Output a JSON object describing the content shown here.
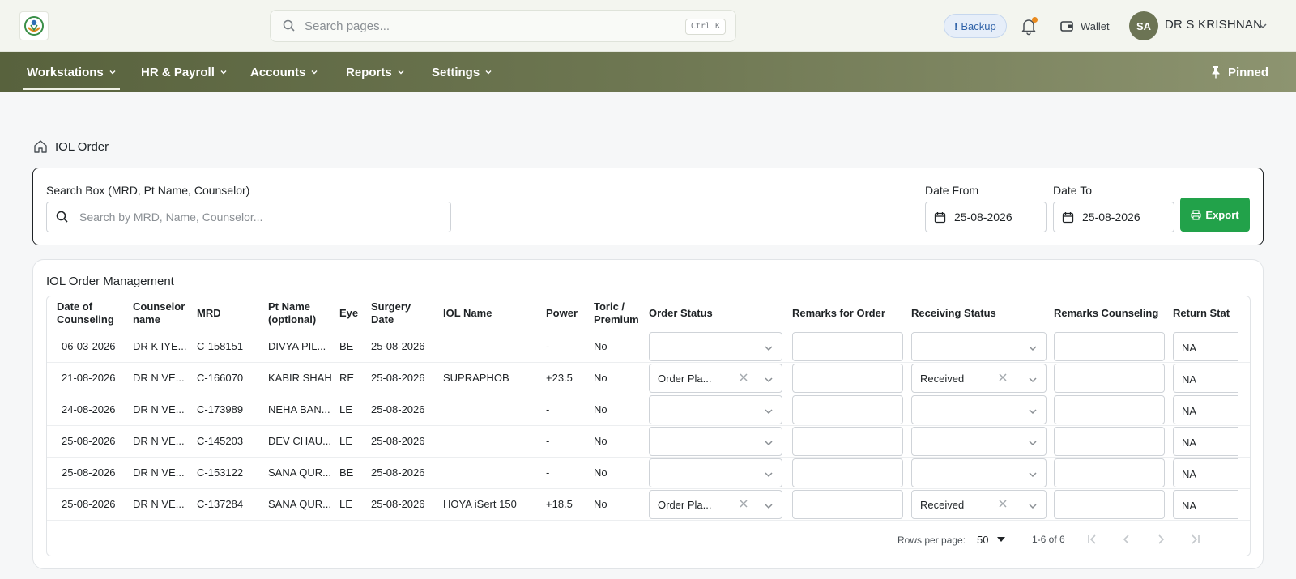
{
  "header": {
    "search_placeholder": "Search pages...",
    "shortcut": "Ctrl K",
    "backup_label": "Backup",
    "wallet_label": "Wallet",
    "avatar_initials": "SA",
    "user_name": "DR S KRISHNAN"
  },
  "nav": {
    "items": [
      {
        "label": "Workstations",
        "active": true
      },
      {
        "label": "HR & Payroll",
        "active": false
      },
      {
        "label": "Accounts",
        "active": false
      },
      {
        "label": "Reports",
        "active": false
      },
      {
        "label": "Settings",
        "active": false
      }
    ],
    "pinned_label": "Pinned"
  },
  "breadcrumb": {
    "title": "IOL Order"
  },
  "filters": {
    "search_label": "Search Box (MRD, Pt Name, Counselor)",
    "search_placeholder": "Search by MRD, Name, Counselor...",
    "date_from_label": "Date From",
    "date_from": "25-08-2026",
    "date_to_label": "Date To",
    "date_to": "25-08-2026",
    "export_label": "Export"
  },
  "table": {
    "title": "IOL Order Management",
    "headers": [
      "Date of\nCounseling",
      "Counselor\nname",
      "MRD",
      "Pt Name\n(optional)",
      "Eye",
      "Surgery\nDate",
      "IOL Name",
      "Power",
      "Toric /\nPremium",
      "Order Status",
      "Remarks for Order",
      "Receiving Status",
      "Remarks Counseling",
      "Return Stat"
    ],
    "rows": [
      {
        "date": "06-03-2026",
        "counselor": "DR K IYE...",
        "mrd": "C-158151",
        "pt_name": "DIVYA PIL...",
        "eye": "BE",
        "surgery_date": "25-08-2026",
        "iol_name": "",
        "power": "-",
        "toric": "No",
        "order_status": "",
        "receiving_status": "",
        "return_status": "NA"
      },
      {
        "date": "21-08-2026",
        "counselor": "DR N VE...",
        "mrd": "C-166070",
        "pt_name": "KABIR SHAH",
        "eye": "RE",
        "surgery_date": "25-08-2026",
        "iol_name": "SUPRAPHOB",
        "power": "+23.5",
        "toric": "No",
        "order_status": "Order Pla...",
        "receiving_status": "Received",
        "return_status": "NA"
      },
      {
        "date": "24-08-2026",
        "counselor": "DR N VE...",
        "mrd": "C-173989",
        "pt_name": "NEHA BAN...",
        "eye": "LE",
        "surgery_date": "25-08-2026",
        "iol_name": "",
        "power": "-",
        "toric": "No",
        "order_status": "",
        "receiving_status": "",
        "return_status": "NA"
      },
      {
        "date": "25-08-2026",
        "counselor": "DR N VE...",
        "mrd": "C-145203",
        "pt_name": "DEV CHAU...",
        "eye": "LE",
        "surgery_date": "25-08-2026",
        "iol_name": "",
        "power": "-",
        "toric": "No",
        "order_status": "",
        "receiving_status": "",
        "return_status": "NA"
      },
      {
        "date": "25-08-2026",
        "counselor": "DR N VE...",
        "mrd": "C-153122",
        "pt_name": "SANA QUR...",
        "eye": "BE",
        "surgery_date": "25-08-2026",
        "iol_name": "",
        "power": "-",
        "toric": "No",
        "order_status": "",
        "receiving_status": "",
        "return_status": "NA"
      },
      {
        "date": "25-08-2026",
        "counselor": "DR N VE...",
        "mrd": "C-137284",
        "pt_name": "SANA QUR...",
        "eye": "LE",
        "surgery_date": "25-08-2026",
        "iol_name": "HOYA iSert 150",
        "power": "+18.5",
        "toric": "No",
        "order_status": "Order Pla...",
        "receiving_status": "Received",
        "return_status": "NA"
      }
    ]
  },
  "pagination": {
    "rows_per_page_label": "Rows per page:",
    "rows_per_page": "50",
    "range": "1-6 of 6"
  },
  "colors": {
    "nav_start": "#58623d",
    "nav_end": "#8d9470",
    "export_green": "#22a24a",
    "avatar_bg": "#6c7454",
    "notification_dot": "#e98a1e"
  }
}
